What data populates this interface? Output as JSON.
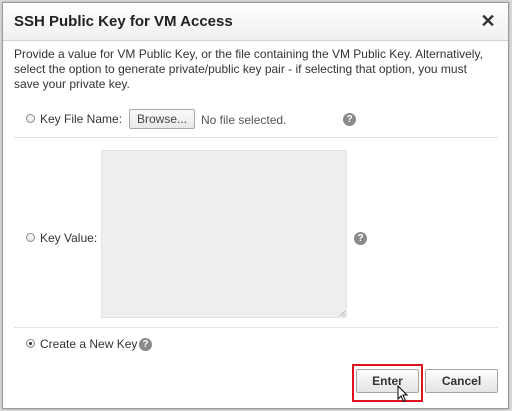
{
  "dialog": {
    "title": "SSH Public Key for VM Access",
    "close_glyph": "✕",
    "description": "Provide a value for VM Public Key, or the file containing the VM Public Key. Alternatively, select the option to generate private/public key pair - if selecting that option, you must save your private key."
  },
  "options": {
    "key_file": {
      "label": "Key File Name:",
      "browse_label": "Browse...",
      "no_file_text": "No file selected.",
      "selected": false
    },
    "key_value": {
      "label": "Key Value:",
      "value": "",
      "selected": false
    },
    "create_new": {
      "label": "Create a New Key",
      "selected": true
    }
  },
  "help_glyph": "?",
  "buttons": {
    "enter": "Enter",
    "cancel": "Cancel"
  },
  "colors": {
    "highlight": "#e0141e",
    "help_icon": "#8a8a8a",
    "textarea_bg": "#eceef0"
  },
  "icons": {
    "close": "close-icon",
    "help": "help-icon",
    "cursor": "mouse-pointer-icon",
    "resize": "resize-grip-icon"
  }
}
